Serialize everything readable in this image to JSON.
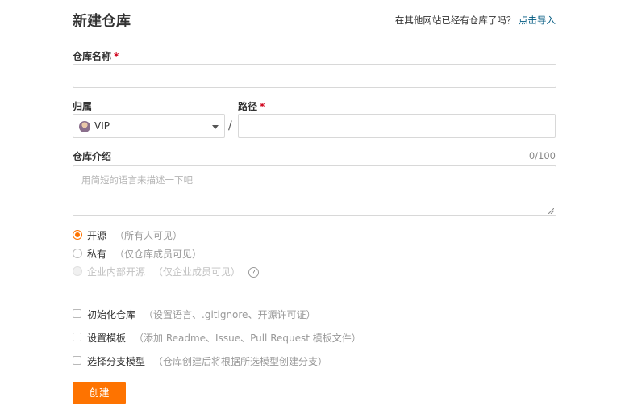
{
  "header": {
    "title": "新建仓库",
    "import_prompt": "在其他网站已经有仓库了吗？",
    "import_link": "点击导入"
  },
  "repo_name": {
    "label": "仓库名称",
    "required_mark": "*",
    "value": ""
  },
  "owner": {
    "label": "归属",
    "selected": "VIP"
  },
  "separator": "/",
  "path": {
    "label": "路径",
    "required_mark": "*",
    "value": ""
  },
  "description": {
    "label": "仓库介绍",
    "counter": "0/100",
    "placeholder": "用简短的语言来描述一下吧"
  },
  "visibility": {
    "options": [
      {
        "label": "开源",
        "hint": "（所有人可见）",
        "state": "checked"
      },
      {
        "label": "私有",
        "hint": "（仅仓库成员可见）",
        "state": "unchecked"
      },
      {
        "label": "企业内部开源",
        "hint": "（仅企业成员可见）",
        "state": "disabled"
      }
    ],
    "help_icon": "?"
  },
  "options": [
    {
      "label": "初始化仓库",
      "hint": "（设置语言、.gitignore、开源许可证）",
      "checked": false
    },
    {
      "label": "设置模板",
      "hint": "（添加 Readme、Issue、Pull Request 模板文件）",
      "checked": false
    },
    {
      "label": "选择分支模型",
      "hint": "（仓库创建后将根据所选模型创建分支）",
      "checked": false
    }
  ],
  "submit_label": "创建",
  "colors": {
    "accent": "#fe7300",
    "link": "#005980",
    "required": "#d0021b"
  }
}
